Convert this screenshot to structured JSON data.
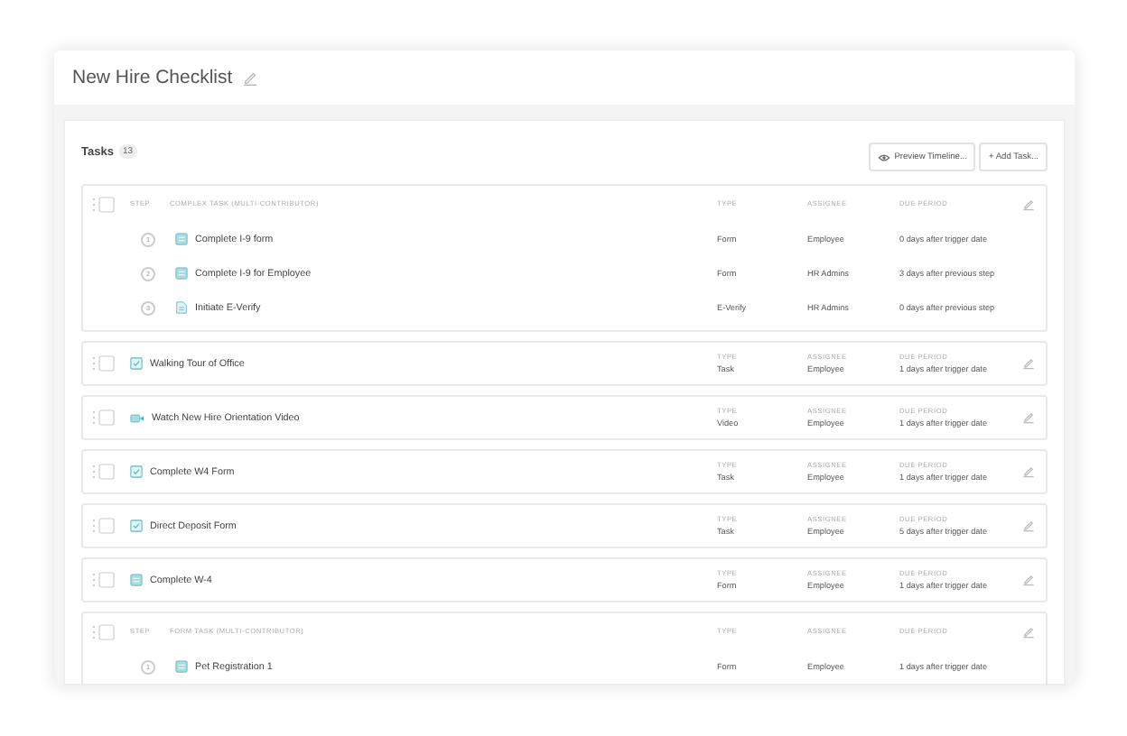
{
  "title": "New Hire Checklist",
  "tasks_heading": {
    "label": "Tasks",
    "count": "13"
  },
  "buttons": [
    {
      "kind": "preview",
      "label": "Preview Timeline..."
    },
    {
      "kind": "add",
      "label": "+ Add Task..."
    }
  ],
  "tasks": [
    {
      "kind": "group",
      "checked": false,
      "step_label": "STEP",
      "title": "COMPLEX TASK (MULTI-CONTRIBUTOR)",
      "type_label": "TYPE",
      "assignee_label": "ASSIGNEE",
      "due_label": "DUE PERIOD",
      "steps": [
        {
          "number": "1",
          "kind": "form",
          "name": "Complete I-9 form",
          "type": "Form",
          "assignee": "Employee",
          "due": "0 days after trigger date"
        },
        {
          "number": "2",
          "kind": "form",
          "name": "Complete I-9 for Employee",
          "type": "Form",
          "assignee": "HR Admins",
          "due": "3 days after previous step"
        },
        {
          "number": "3",
          "kind": "doc",
          "name": "Initiate E-Verify",
          "type": "E-Verify",
          "assignee": "HR Admins",
          "due": "0 days after previous step"
        }
      ]
    },
    {
      "kind": "task",
      "checked": false,
      "name": "Walking Tour of Office",
      "type_label": "TYPE",
      "type": "Task",
      "assignee_label": "ASSIGNEE",
      "assignee": "Employee",
      "due_label": "DUE PERIOD",
      "due": "1 days after trigger date"
    },
    {
      "kind": "video",
      "checked": false,
      "name": "Watch New Hire Orientation Video",
      "type_label": "TYPE",
      "type": "Video",
      "assignee_label": "ASSIGNEE",
      "assignee": "Employee",
      "due_label": "DUE PERIOD",
      "due": "1 days after trigger date"
    },
    {
      "kind": "task",
      "checked": false,
      "name": "Complete W4 Form",
      "type_label": "TYPE",
      "type": "Task",
      "assignee_label": "ASSIGNEE",
      "assignee": "Employee",
      "due_label": "DUE PERIOD",
      "due": "1 days after trigger date"
    },
    {
      "kind": "task",
      "checked": false,
      "name": "Direct Deposit Form",
      "type_label": "TYPE",
      "type": "Task",
      "assignee_label": "ASSIGNEE",
      "assignee": "Employee",
      "due_label": "DUE PERIOD",
      "due": "5 days after trigger date"
    },
    {
      "kind": "form",
      "checked": false,
      "name": "Complete W-4",
      "type_label": "TYPE",
      "type": "Form",
      "assignee_label": "ASSIGNEE",
      "assignee": "Employee",
      "due_label": "DUE PERIOD",
      "due": "1 days after trigger date"
    },
    {
      "kind": "group",
      "checked": false,
      "step_label": "STEP",
      "title": "FORM TASK (MULTI-CONTRIBUTOR)",
      "type_label": "TYPE",
      "assignee_label": "ASSIGNEE",
      "due_label": "DUE PERIOD",
      "steps": [
        {
          "number": "1",
          "kind": "form",
          "name": "Pet Registration 1",
          "type": "Form",
          "assignee": "Employee",
          "due": "1 days after trigger date"
        }
      ]
    }
  ]
}
